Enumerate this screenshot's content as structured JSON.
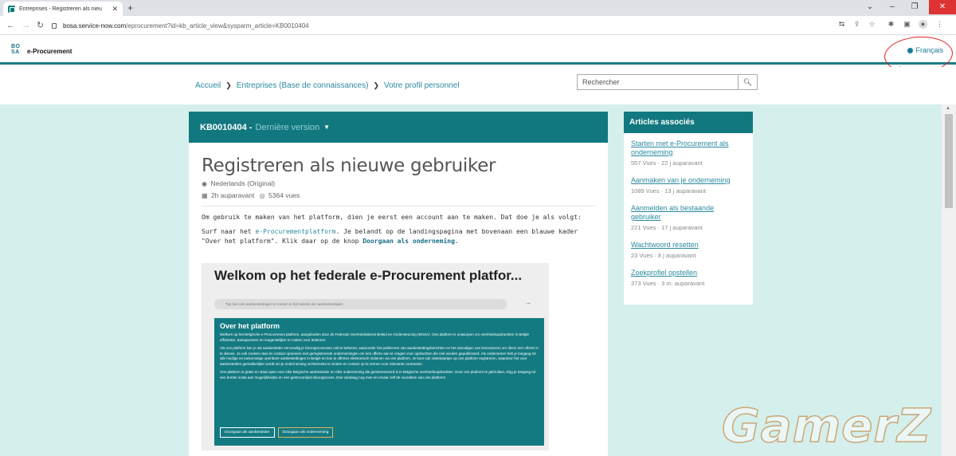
{
  "browser": {
    "tab_title": "Entreprises - Registreren als nieu",
    "url_host": "bosa.service-now.com",
    "url_path": "/eprocurement?id=kb_article_view&sysparm_article=KB0010404"
  },
  "site": {
    "logo_text": "BO SA",
    "brand": "e-Procurement",
    "language": "Français"
  },
  "breadcrumb": {
    "items": [
      "Accueil",
      "Entreprises (Base de connaissances)",
      "Votre profil personnel"
    ]
  },
  "search": {
    "placeholder": "Rechercher"
  },
  "article": {
    "number": "KB0010404 -",
    "version": "Dernière version",
    "title": "Registreren als nieuwe gebruiker",
    "language_meta": "Nederlands (Original)",
    "age": "2h auparavant",
    "views": "5364 vues",
    "p1": "Om gebruik te maken van het platform, dien je eerst een account aan te maken. Dat doe je als volgt:",
    "p2_before": "Surf naar het ",
    "p2_link": "e-Procurementplatform",
    "p2_middle": ". Je belandt op de landingspagina met bovenaan een blauwe kader \"Over het platform\". Klik daar op de knop ",
    "p2_bold": "Doorgaan als onderneming",
    "p2_end": "."
  },
  "screenshot": {
    "title": "Welkom op het federale e-Procurement platfor...",
    "search_placeholder": "Typ hier een aanbestedingen te zoeken in het bulletin der aanbestedingen",
    "box_title": "Over het platform",
    "box_p1": "Welkom op het Belgische e-Procurement platform, aangeboden door de Federale Overheidsdienst Beleid en Ondersteuning (BOSA). Ons platform is ontworpen om overheidsopdrachten in België efficiënter, transparanter en toegankelijker te maken voor iedereen.",
    "box_p2": "Via ons platform kan je als aanbesteder eenvoudig je inkoopprocessen online beheren, waaronder het publiceren van aanbestedingsberichten en het uitnodigen van leveranciers om direct een offerte in te dienen. Je ook zoeken naar en contact opnemen met geregistreerde ondernemingen om een offerte aan te vragen voor opdrachten die niet worden gepubliceerd. Als ondernemer heb je toegang tot alle huidige en toekomstige openbare aanbestedingen in België en kan je offertes elektronisch indienen via ons platform. Je kunt ook visitekaartjes op ons platform registreren, waardoor het voor aanbesteders gemakkelijker wordt om je onderneming rechtstreeks te vinden en contact op te nemen voor relevante contracten.",
    "box_p3": "Ons platform is gratis en staat open voor elke Belgische aanbesteder en elke onderneming die geïnteresseerd is in Belgische overheidsopdrachten. Door ons platform te gebruiken, krijg je toegang tot een breder scala aan mogelijkheden en een gestroomlijnd inkoopproces. Doe vandaag nog mee en ervaar zelf de voordelen van ons platform!",
    "btn1": "Doorgaan als aanbesteder",
    "btn2": "Doorgaan als onderneming"
  },
  "related": {
    "heading": "Articles associés",
    "items": [
      {
        "title": "Starten met e-Procurement als onderneming",
        "views": "557 Vues",
        "age": "22 j auparavant"
      },
      {
        "title": "Aanmaken van je onderneming",
        "views": "1089 Vues",
        "age": "13 j auparavant"
      },
      {
        "title": "Aanmelden als bestaande gebruiker",
        "views": "221 Vues",
        "age": "17 j auparavant"
      },
      {
        "title": "Wachtwoord resetten",
        "views": "23 Vues",
        "age": "8 j auparavant"
      },
      {
        "title": "Zoekprofiel opstellen",
        "views": "373 Vues",
        "age": "3 m. auparavant"
      }
    ]
  },
  "watermark": "GamerZ",
  "colors": {
    "header_teal": "#12787f",
    "link": "#2a8a9e",
    "content_bg": "#d5efec",
    "annotation_red": "#e02020"
  }
}
